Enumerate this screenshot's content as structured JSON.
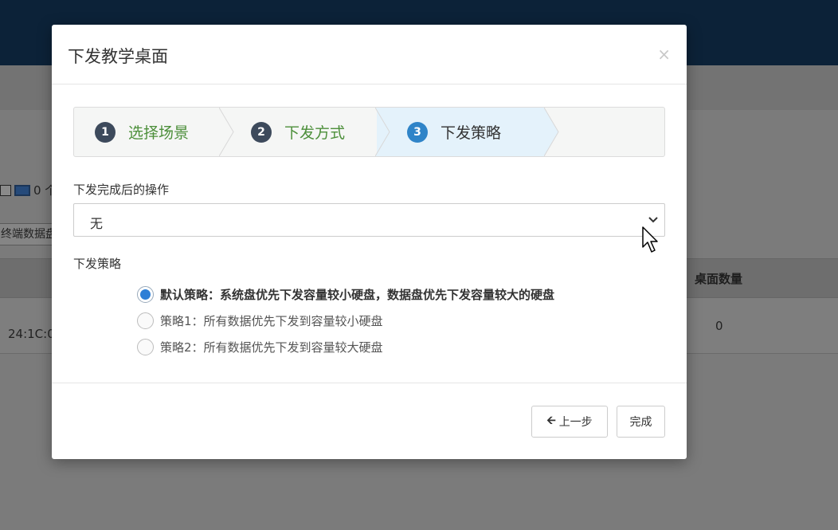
{
  "background": {
    "count_text": "0 个",
    "terminal_button": "终端数据盘",
    "table_header_col": "桌面数量",
    "row_mac": "24:1C:0",
    "row_count": "0"
  },
  "modal": {
    "title": "下发教学桌面",
    "close": "×",
    "steps": [
      {
        "num": "1",
        "label": "选择场景"
      },
      {
        "num": "2",
        "label": "下发方式"
      },
      {
        "num": "3",
        "label": "下发策略"
      }
    ],
    "after_action": {
      "label": "下发完成后的操作",
      "value": "无"
    },
    "strategy": {
      "label": "下发策略",
      "options": [
        {
          "text": "默认策略：系统盘优先下发容量较小硬盘，数据盘优先下发容量较大的硬盘",
          "checked": true
        },
        {
          "text": "策略1：所有数据优先下发到容量较小硬盘",
          "checked": false
        },
        {
          "text": "策略2：所有数据优先下发到容量较大硬盘",
          "checked": false
        }
      ]
    },
    "buttons": {
      "prev": "上一步",
      "done": "完成"
    }
  },
  "colors": {
    "header": "#0c2238",
    "step_active": "#2f84c8",
    "step_done_text": "#4c8f3a",
    "radio_checked": "#2e7fd6"
  }
}
